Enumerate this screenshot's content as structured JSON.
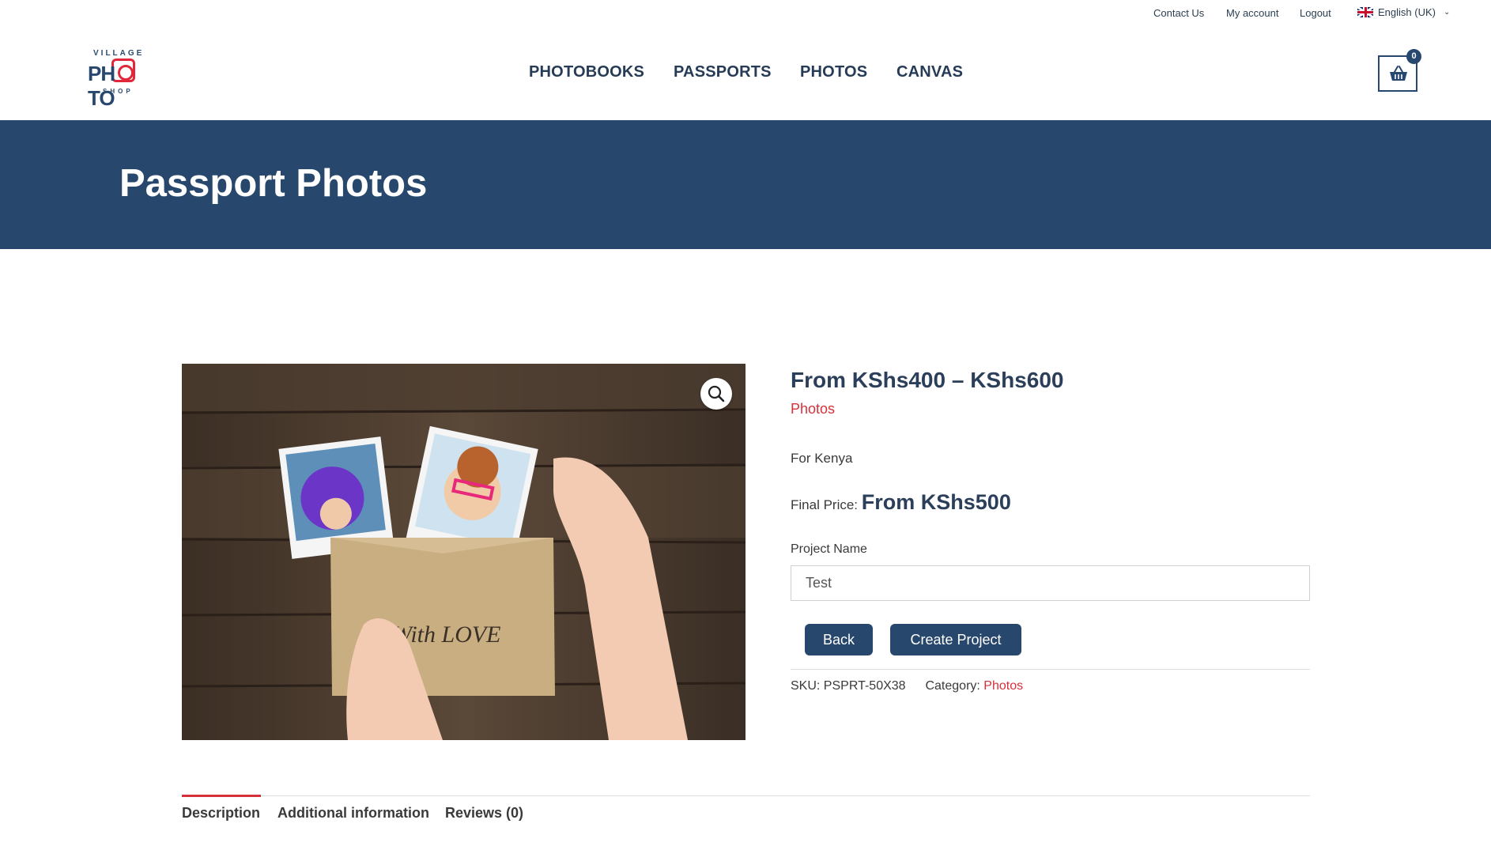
{
  "topbar": {
    "contact": "Contact Us",
    "account": "My account",
    "logout": "Logout",
    "language": "English (UK)"
  },
  "logo": {
    "line1": "VILLAGE",
    "line2a": "PH",
    "line2b": "TO",
    "line3": "SHOP"
  },
  "nav": [
    "PHOTOBOOKS",
    "PASSPORTS",
    "PHOTOS",
    "CANVAS"
  ],
  "cart": {
    "count": "0"
  },
  "banner": {
    "title": "Passport Photos"
  },
  "product": {
    "price_range": "From KShs400 – KShs600",
    "category_link": "Photos",
    "short_description": "For Kenya",
    "final_price_label": "Final Price:",
    "final_price_value": "From KShs500",
    "project_name_label": "Project Name",
    "project_name_value": "Test",
    "back_label": "Back",
    "create_label": "Create Project",
    "sku_label": "SKU:",
    "sku_value": "PSPRT-50X38",
    "category_label": "Category:",
    "category_value": "Photos",
    "image_text": "With LOVE"
  },
  "tabs": [
    "Description",
    "Additional information",
    "Reviews (0)"
  ],
  "colors": {
    "brand_navy": "#28476d",
    "accent_red": "#d6313a"
  },
  "icons": {
    "search": "magnifier-icon",
    "cart": "basket-icon",
    "flag": "uk-flag-icon",
    "chevron": "chevron-down-icon"
  }
}
